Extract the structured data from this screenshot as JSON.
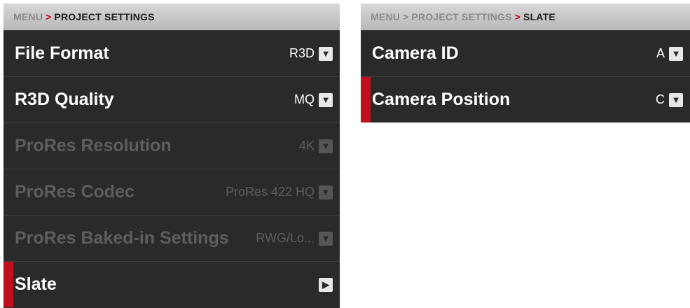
{
  "left": {
    "breadcrumb": {
      "root": "MENU",
      "sep": ">",
      "current": "PROJECT SETTINGS"
    },
    "rows": [
      {
        "label": "File Format",
        "value": "R3D",
        "control": "chevron-down-icon"
      },
      {
        "label": "R3D Quality",
        "value": "MQ",
        "control": "chevron-down-icon"
      },
      {
        "label": "ProRes Resolution",
        "value": "4K",
        "control": "chevron-down-icon"
      },
      {
        "label": "ProRes Codec",
        "value": "ProRes 422 HQ",
        "control": "chevron-down-icon"
      },
      {
        "label": "ProRes Baked-in Settings",
        "value": "RWG/Lo...",
        "control": "chevron-down-icon"
      },
      {
        "label": "Slate",
        "value": "",
        "control": "chevron-right-icon"
      }
    ]
  },
  "right": {
    "breadcrumb": {
      "root": "MENU",
      "sep1": ">",
      "mid": "PROJECT SETTINGS",
      "sep2": ">",
      "current": "SLATE"
    },
    "rows": [
      {
        "label": "Camera ID",
        "value": "A",
        "control": "chevron-down-icon"
      },
      {
        "label": "Camera Position",
        "value": "C",
        "control": "chevron-down-icon"
      }
    ]
  },
  "colors": {
    "accent": "#c0101e",
    "panel": "#2a2a2a",
    "disabled_text": "#5e5e5e"
  }
}
